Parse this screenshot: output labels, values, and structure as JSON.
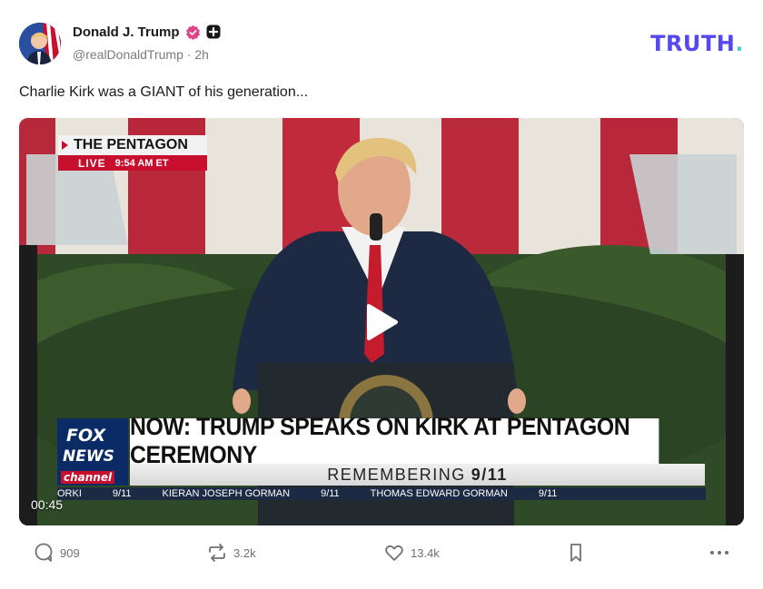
{
  "author": {
    "display_name": "Donald J. Trump",
    "handle": "@realDonaldTrump",
    "separator": " · ",
    "time_ago": "2h"
  },
  "brand": {
    "name": "TRUTH",
    "dot": "."
  },
  "post": {
    "text": "Charlie Kirk was a GIANT of his generation..."
  },
  "video": {
    "duration": "00:45",
    "overlay": {
      "location_title": "THE PENTAGON",
      "live_label": "LIVE",
      "live_time": "9:54 AM ET",
      "network_line1": "FOX",
      "network_line2": "NEWS",
      "network_line3": "channel",
      "headline": "NOW: TRUMP SPEAKS ON KIRK AT PENTAGON CEREMONY",
      "subline_prefix": "REMEMBERING",
      "subline_bold": "9/11",
      "ticker": [
        "ORKI",
        "9/11",
        "KIERAN JOSEPH GORMAN",
        "9/11",
        "THOMAS EDWARD GORMAN",
        "9/11"
      ]
    }
  },
  "actions": {
    "replies": "909",
    "retruths": "3.2k",
    "likes": "13.4k"
  },
  "colors": {
    "brand": "#5448ee",
    "brand_dot": "#4fd3c6",
    "verified": "#e0428a",
    "text": "#1b1b1f",
    "muted": "#7a7a82"
  },
  "icons": [
    "avatar",
    "verified-badge-icon",
    "plus-badge-icon",
    "play-icon",
    "reply-icon",
    "retruth-icon",
    "like-icon",
    "bookmark-icon",
    "more-icon"
  ]
}
